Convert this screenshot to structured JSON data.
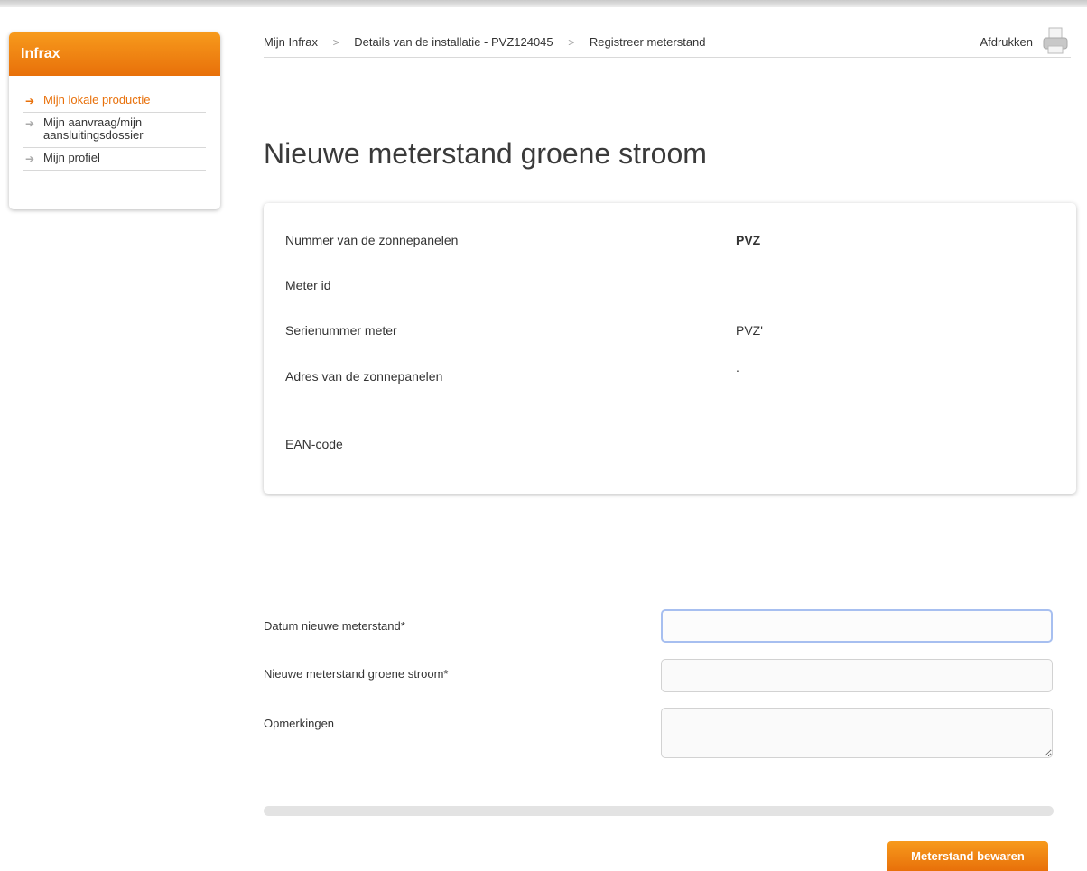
{
  "sidebar": {
    "title": "Infrax",
    "items": [
      {
        "label": "Mijn lokale productie"
      },
      {
        "label": "Mijn aanvraag/mijn aansluitingsdossier"
      },
      {
        "label": "Mijn profiel"
      }
    ]
  },
  "breadcrumb": {
    "items": [
      "Mijn Infrax",
      "Details van de installatie - PVZ124045",
      "Registreer meterstand"
    ],
    "separator": ">"
  },
  "print": {
    "label": "Afdrukken",
    "icon": "printer-icon"
  },
  "page_title": "Nieuwe meterstand groene stroom",
  "info": {
    "rows": [
      {
        "label": "Nummer van de zonnepanelen",
        "value": "PVZ"
      },
      {
        "label": "Meter id",
        "value": ""
      },
      {
        "label": "Serienummer meter",
        "value": "PVZ'"
      },
      {
        "label": "Adres van de zonnepanelen",
        "value": "."
      },
      {
        "label": "EAN-code",
        "value": ""
      }
    ]
  },
  "form": {
    "date_label": "Datum nieuwe meterstand*",
    "date_value": "",
    "reading_label": "Nieuwe meterstand groene stroom*",
    "reading_value": "",
    "remarks_label": "Opmerkingen",
    "remarks_value": ""
  },
  "save_button": "Meterstand bewaren",
  "colors": {
    "accent": "#e8700a",
    "focus": "#a7bff0"
  }
}
